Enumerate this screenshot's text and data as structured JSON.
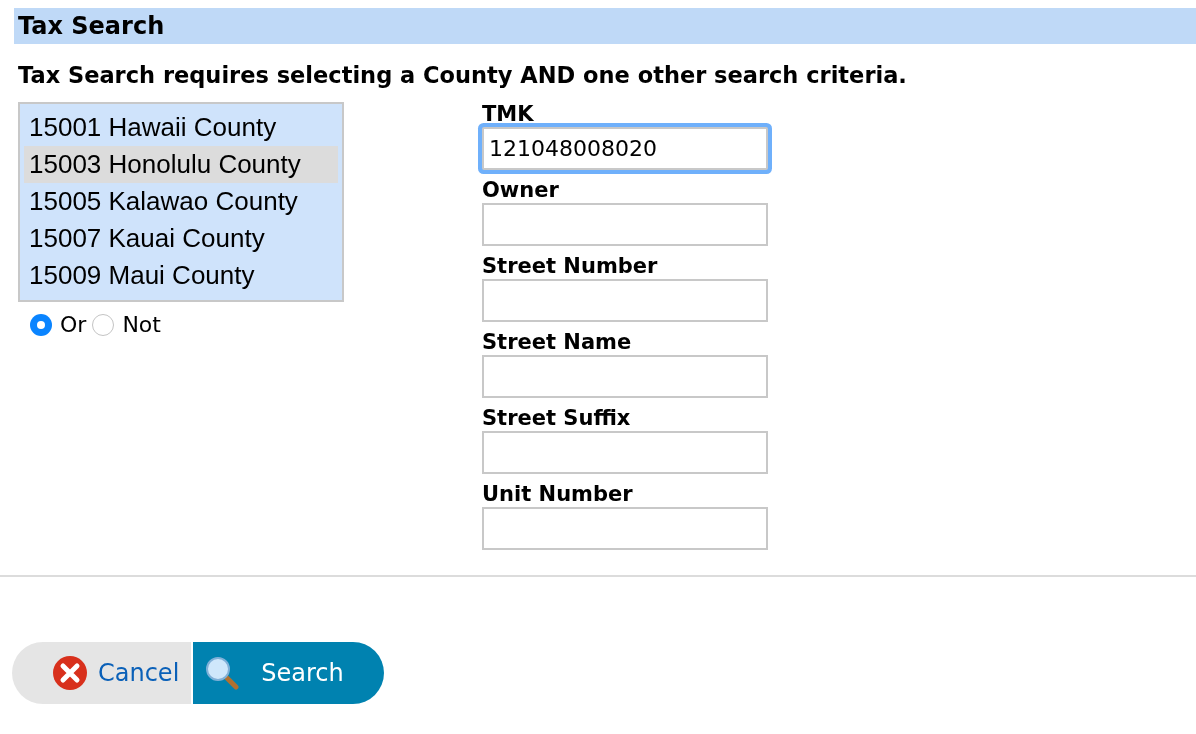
{
  "header": {
    "title": "Tax Search"
  },
  "instruction": "Tax Search requires selecting a County AND one other search criteria.",
  "counties": [
    {
      "label": "15001 Hawaii County",
      "selected": false
    },
    {
      "label": "15003 Honolulu County",
      "selected": true
    },
    {
      "label": "15005 Kalawao County",
      "selected": false
    },
    {
      "label": "15007 Kauai County",
      "selected": false
    },
    {
      "label": "15009 Maui County",
      "selected": false
    }
  ],
  "mode": [
    {
      "label": "Or",
      "selected": true
    },
    {
      "label": "Not",
      "selected": false
    }
  ],
  "fields": [
    {
      "label": "TMK",
      "value": "121048008020",
      "focused": true
    },
    {
      "label": "Owner",
      "focused": false
    },
    {
      "label": "Street Number",
      "focused": false
    },
    {
      "label": "Street Name",
      "focused": false
    },
    {
      "label": "Street Suffix",
      "focused": false
    },
    {
      "label": "Unit Number",
      "focused": false
    }
  ],
  "buttons": [
    {
      "kind": "cancel",
      "label": "Cancel"
    },
    {
      "kind": "search",
      "label": "Search"
    }
  ]
}
